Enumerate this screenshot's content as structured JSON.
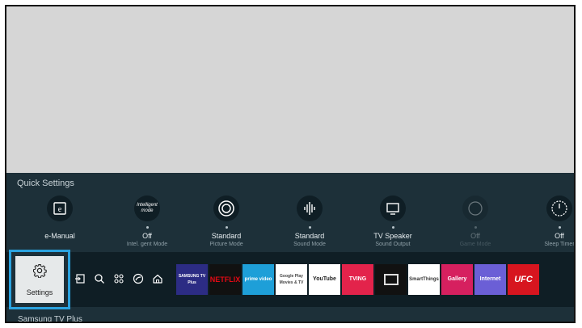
{
  "quick_settings": {
    "title": "Quick Settings",
    "items": [
      {
        "icon": "manual-icon",
        "value": "e-Manual",
        "sub": ""
      },
      {
        "icon": "intelligent-mode-icon",
        "icon_text": "Intelligent mode",
        "value": "Off",
        "sub": "Intel. gent Mode"
      },
      {
        "icon": "picture-mode-icon",
        "value": "Standard",
        "sub": "Picture Mode"
      },
      {
        "icon": "sound-mode-icon",
        "value": "Standard",
        "sub": "Sound Mode"
      },
      {
        "icon": "tv-speaker-icon",
        "value": "TV Speaker",
        "sub": "Sound Output"
      },
      {
        "icon": "game-mode-icon",
        "value": "Off",
        "sub": "Game Mode"
      },
      {
        "icon": "sleep-timer-icon",
        "value": "Off",
        "sub": "Sleep Timer"
      }
    ]
  },
  "settings_tile": {
    "label": "Settings",
    "icon": "gear-icon"
  },
  "nav_icons": [
    "source-icon",
    "search-icon",
    "apps-icon",
    "ambient-icon",
    "home-icon"
  ],
  "apps": [
    {
      "name": "SAMSUNG TV Plus",
      "label": "SAMSUNG TV Plus",
      "bg": "#2c2c84",
      "fg": "#ffffff"
    },
    {
      "name": "Netflix",
      "label": "NETFLIX",
      "bg": "#111111",
      "fg": "#e50914"
    },
    {
      "name": "Prime Video",
      "label": "prime video",
      "bg": "#1e9fd8",
      "fg": "#ffffff"
    },
    {
      "name": "Google Play Movies & TV",
      "label": "Google Play Movies & TV",
      "bg": "#ffffff",
      "fg": "#444444"
    },
    {
      "name": "YouTube",
      "label": "YouTube",
      "bg": "#ffffff",
      "fg": "#222222"
    },
    {
      "name": "TVING",
      "label": "TVING",
      "bg": "#e3234b",
      "fg": "#ffffff"
    },
    {
      "name": "Apple TV",
      "label": "",
      "bg": "#111111",
      "fg": "#ffffff"
    },
    {
      "name": "SmartThings",
      "label": "SmartThings",
      "bg": "#ffffff",
      "fg": "#333333"
    },
    {
      "name": "Gallery",
      "label": "Gallery",
      "bg": "#d6205f",
      "fg": "#ffffff"
    },
    {
      "name": "Internet",
      "label": "Internet",
      "bg": "#6b5fd6",
      "fg": "#ffffff"
    },
    {
      "name": "UFC",
      "label": "UFC",
      "bg": "#d7151f",
      "fg": "#ffffff"
    }
  ],
  "footer": {
    "text": "Samsung TV Plus"
  },
  "colors": {
    "panel": "#1d3039",
    "bar": "#0f1e25",
    "focus": "#2aa3e0"
  }
}
